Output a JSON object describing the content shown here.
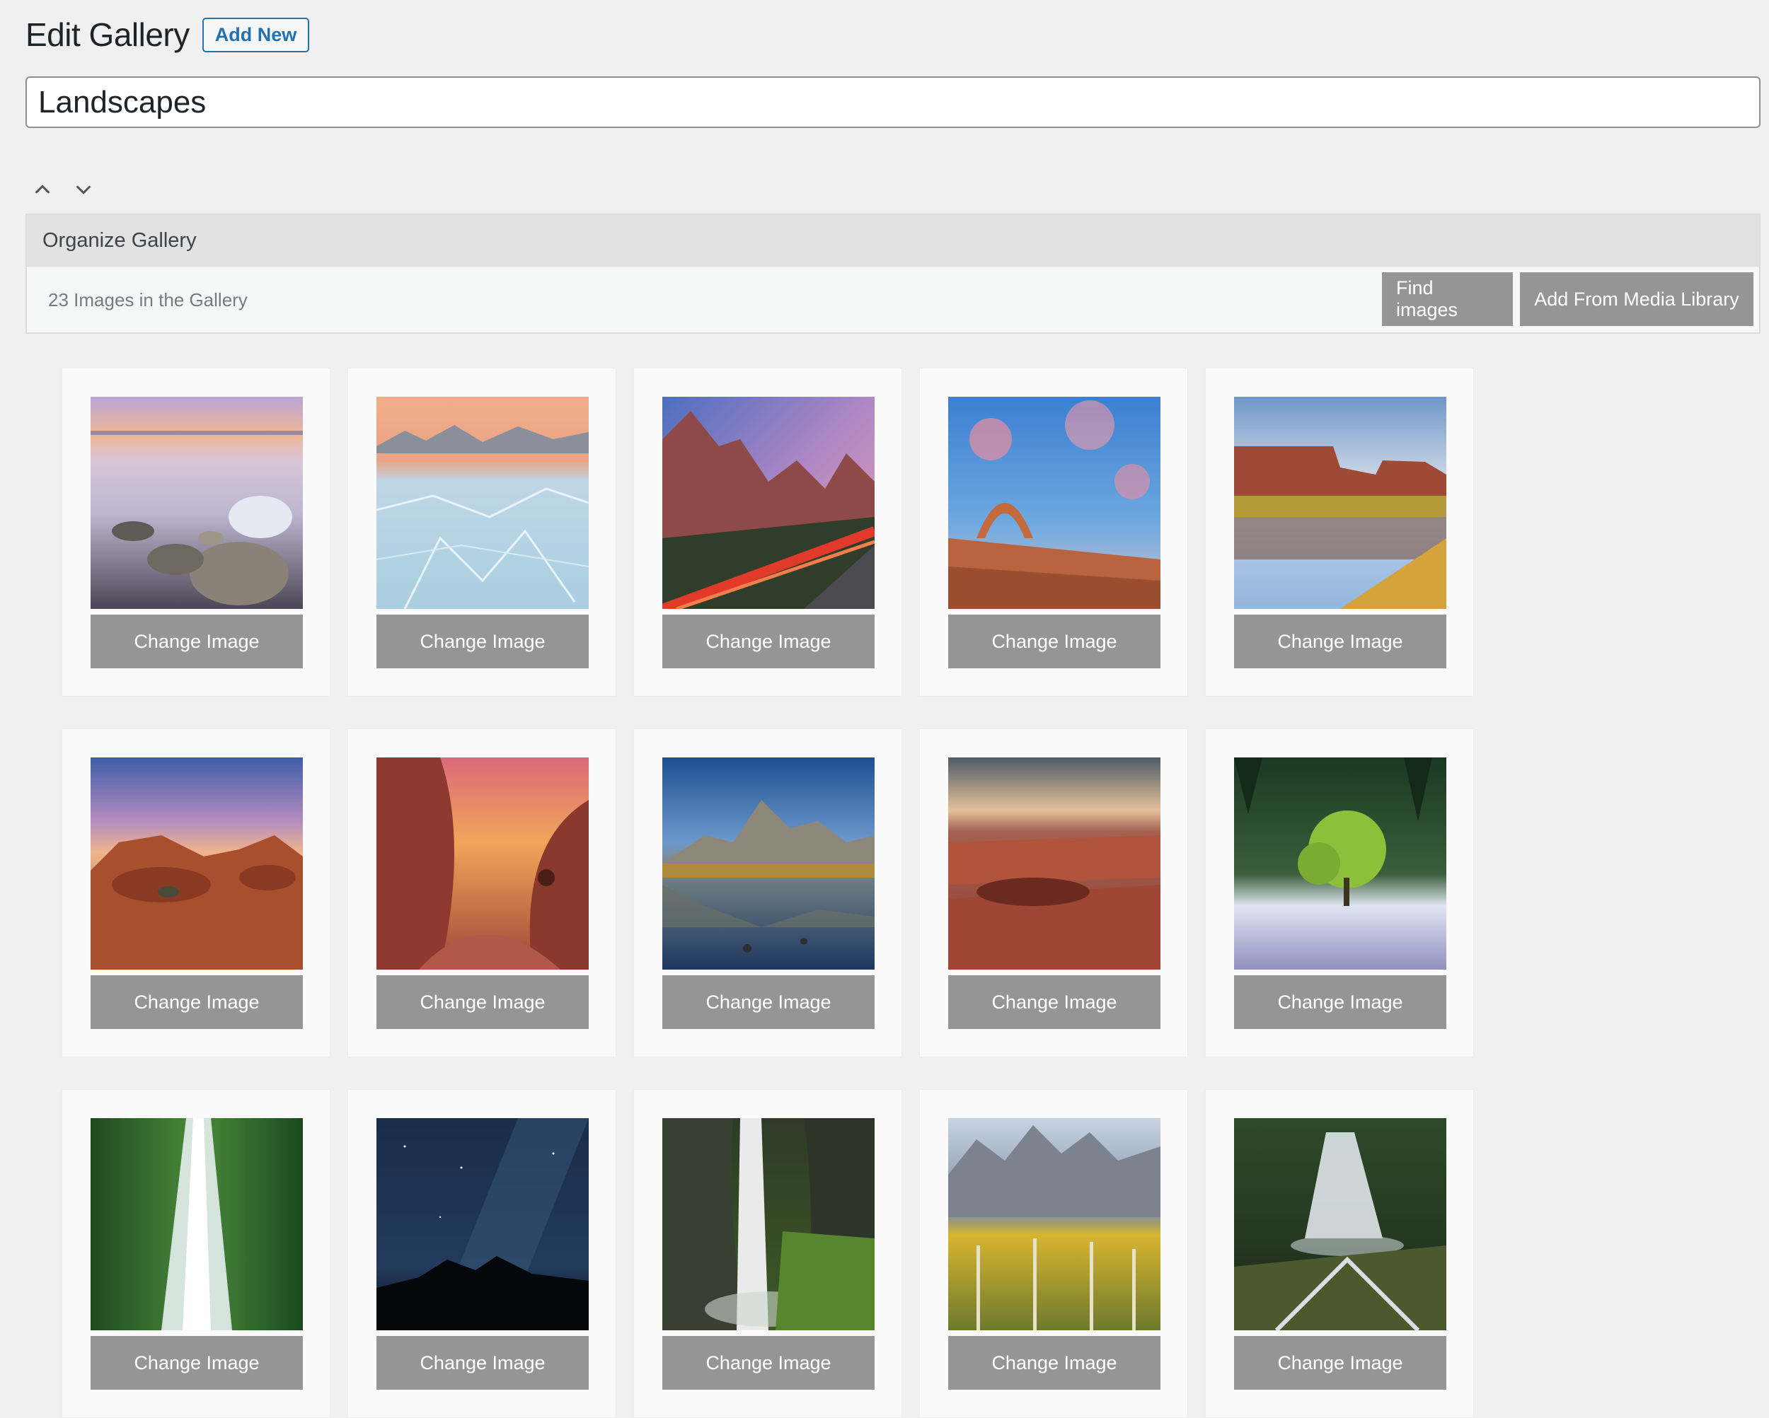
{
  "header": {
    "title": "Edit Gallery",
    "add_new_label": "Add New"
  },
  "title_field": {
    "value": "Landscapes"
  },
  "panel": {
    "title": "Organize Gallery",
    "image_count_text": "23 Images in the Gallery",
    "find_images_label": "Find images",
    "add_from_library_label": "Add From Media Library"
  },
  "gallery": {
    "change_image_label": "Change Image",
    "items": [
      {
        "subject": "lake-rocks-sunset"
      },
      {
        "subject": "ice-lake-mountains"
      },
      {
        "subject": "canyon-road-light-trails"
      },
      {
        "subject": "delicate-arch"
      },
      {
        "subject": "mesa-reflection"
      },
      {
        "subject": "red-rocks-dusk"
      },
      {
        "subject": "slot-canyon-sunset"
      },
      {
        "subject": "teton-reflection"
      },
      {
        "subject": "red-rock-formation"
      },
      {
        "subject": "tree-in-fog"
      },
      {
        "subject": "forest-waterfall"
      },
      {
        "subject": "milky-way-mountains"
      },
      {
        "subject": "canyon-waterfall"
      },
      {
        "subject": "aspens-mountains"
      },
      {
        "subject": "mossy-waterfall"
      }
    ]
  }
}
